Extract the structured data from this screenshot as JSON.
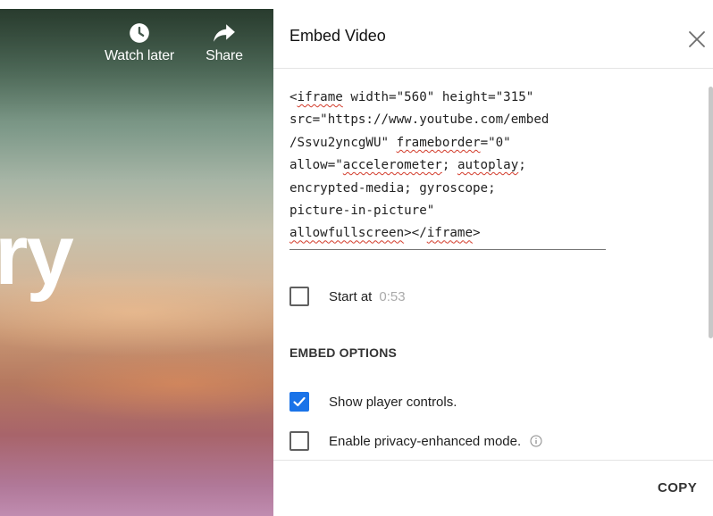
{
  "video": {
    "watch_later_label": "Watch later",
    "share_label": "Share",
    "title_fragment": "ry"
  },
  "dialog": {
    "title": "Embed Video",
    "embed_code_lines": [
      "<iframe width=\"560\" height=\"315\"",
      "src=\"https://www.youtube.com/embed",
      "/Ssvu2yncgWU\" frameborder=\"0\"",
      "allow=\"accelerometer; autoplay;",
      "encrypted-media; gyroscope;",
      "picture-in-picture\"",
      "allowfullscreen></iframe>"
    ],
    "start_at": {
      "label": "Start at",
      "time": "0:53",
      "checked": false
    },
    "embed_options_heading": "EMBED OPTIONS",
    "options": [
      {
        "label": "Show player controls.",
        "checked": true
      },
      {
        "label": "Enable privacy-enhanced mode.",
        "checked": false
      }
    ],
    "copy_label": "COPY"
  },
  "icons": {
    "watch_later": "clock-icon",
    "share": "share-arrow-icon",
    "close": "close-icon",
    "info": "info-icon",
    "check": "check-icon"
  },
  "colors": {
    "checkbox_checked": "#1a73e8",
    "spellcheck_underline": "#d23b2a",
    "muted_text": "#aaaaaa"
  }
}
